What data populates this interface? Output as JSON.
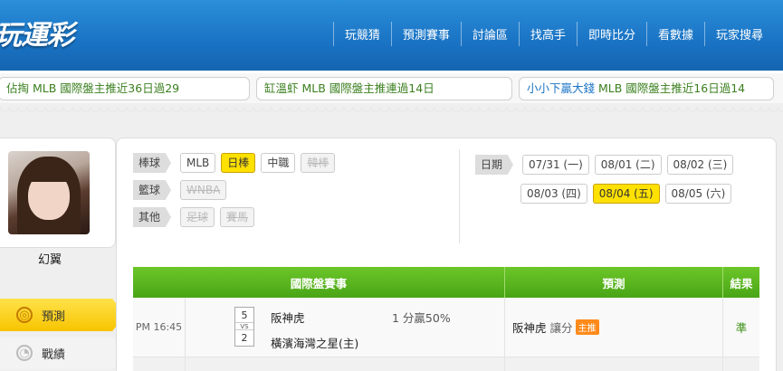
{
  "header": {
    "logo": "玩運彩",
    "nav": [
      "玩競猜",
      "預測賽事",
      "討論區",
      "找高手",
      "即時比分",
      "看數據",
      "玩家搜尋"
    ]
  },
  "ticker": [
    {
      "user": "佔掏",
      "text": " MLB 國際盤主推近36日過29"
    },
    {
      "user": "缸溫虾",
      "text": " MLB 國際盤主推連過14日"
    },
    {
      "user": "小小下贏大錢",
      "text": " MLB 國際盤主推近16日過14"
    }
  ],
  "profile": {
    "name": "幻翼"
  },
  "sidebar": [
    {
      "label": "預測",
      "icon": "target-icon",
      "active": true
    },
    {
      "label": "戰績",
      "icon": "record-icon",
      "active": false
    }
  ],
  "filters": {
    "baseball": {
      "tag": "棒球",
      "options": [
        {
          "label": "MLB",
          "state": "normal"
        },
        {
          "label": "日棒",
          "state": "on"
        },
        {
          "label": "中職",
          "state": "normal"
        },
        {
          "label": "韓棒",
          "state": "off"
        }
      ]
    },
    "basketball": {
      "tag": "籃球",
      "options": [
        {
          "label": "WNBA",
          "state": "off"
        }
      ]
    },
    "other": {
      "tag": "其他",
      "options": [
        {
          "label": "足球",
          "state": "off"
        },
        {
          "label": "賽馬",
          "state": "off"
        }
      ]
    }
  },
  "dates": {
    "tag": "日期",
    "row1": [
      {
        "label": "07/31 (一)",
        "state": "normal"
      },
      {
        "label": "08/01 (二)",
        "state": "normal"
      },
      {
        "label": "08/02 (三)",
        "state": "normal"
      }
    ],
    "row2": [
      {
        "label": "08/03 (四)",
        "state": "normal"
      },
      {
        "label": "08/04 (五)",
        "state": "on"
      },
      {
        "label": "08/05 (六)",
        "state": "normal"
      }
    ]
  },
  "table": {
    "headers": {
      "game": "國際盤賽事",
      "prediction": "預測",
      "result": "結果"
    },
    "rows": [
      {
        "time": "PM 16:45",
        "score1": "5",
        "vs": "VS",
        "score2": "2",
        "team1": "阪神虎",
        "team2": "橫濱海灣之星(主)",
        "odds": "1 分贏50%",
        "pred_team": "阪神虎",
        "pred_type": "讓分",
        "pred_badge": "主推",
        "result": "準"
      }
    ]
  },
  "colors": {
    "header": "#1a73c4",
    "accent_yellow": "#ffe100",
    "table_green": "#5ab520",
    "result_green": "#3a8f12"
  }
}
